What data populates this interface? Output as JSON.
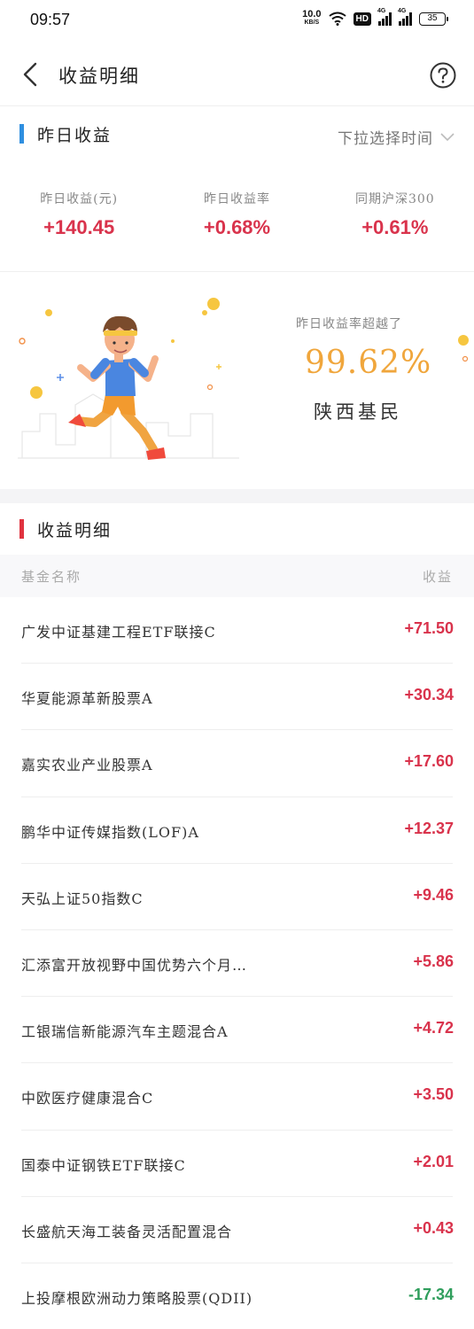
{
  "status_bar": {
    "time": "09:57",
    "net_speed": "10.0",
    "net_unit": "KB/S",
    "hd": "HD",
    "sig1": "4G",
    "sig2": "4G",
    "battery": "35"
  },
  "header": {
    "title": "收益明细",
    "back_icon": "chevron-left-icon",
    "help_icon": "question-circle-icon"
  },
  "yesterday": {
    "title": "昨日收益",
    "time_select": "下拉选择时间",
    "accent": "#2f8fe0",
    "stats": [
      {
        "label": "昨日收益(元)",
        "value": "+140.45"
      },
      {
        "label": "昨日收益率",
        "value": "+0.68%"
      },
      {
        "label": "同期沪深300",
        "value": "+0.61%"
      }
    ]
  },
  "promo": {
    "label": "昨日收益率超越了",
    "percent": "99.62%",
    "region": "陕西基民"
  },
  "detail": {
    "title": "收益明细",
    "accent": "#e0333f",
    "col_name": "基金名称",
    "col_amount": "收益",
    "rows": [
      {
        "name": "广发中证基建工程ETF联接C",
        "amount": "+71.50",
        "sign": "pos"
      },
      {
        "name": "华夏能源革新股票A",
        "amount": "+30.34",
        "sign": "pos"
      },
      {
        "name": "嘉实农业产业股票A",
        "amount": "+17.60",
        "sign": "pos"
      },
      {
        "name": "鹏华中证传媒指数(LOF)A",
        "amount": "+12.37",
        "sign": "pos"
      },
      {
        "name": "天弘上证50指数C",
        "amount": "+9.46",
        "sign": "pos"
      },
      {
        "name": "汇添富开放视野中国优势六个月…",
        "amount": "+5.86",
        "sign": "pos"
      },
      {
        "name": "工银瑞信新能源汽车主题混合A",
        "amount": "+4.72",
        "sign": "pos"
      },
      {
        "name": "中欧医疗健康混合C",
        "amount": "+3.50",
        "sign": "pos"
      },
      {
        "name": "国泰中证钢铁ETF联接C",
        "amount": "+2.01",
        "sign": "pos"
      },
      {
        "name": "长盛航天海工装备灵活配置混合",
        "amount": "+0.43",
        "sign": "pos"
      },
      {
        "name": "上投摩根欧洲动力策略股票(QDII)",
        "amount": "-17.34",
        "sign": "neg"
      }
    ]
  },
  "colors": {
    "positive": "#d9334c",
    "negative": "#2f9e5c",
    "promo_percent": "#f0a63c"
  }
}
